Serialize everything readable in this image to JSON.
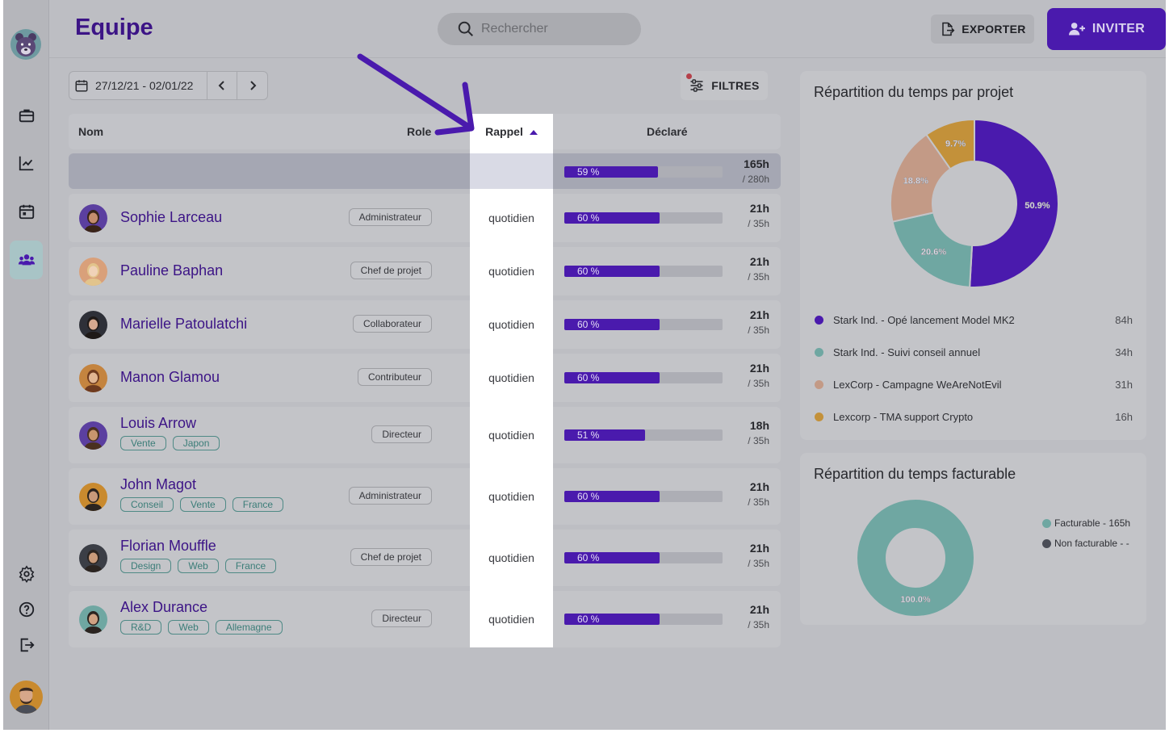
{
  "header": {
    "title": "Equipe",
    "search_placeholder": "Rechercher",
    "export_label": "EXPORTER",
    "invite_label": "INVITER"
  },
  "toolbar": {
    "date_range": "27/12/21 - 02/01/22",
    "filters_label": "FILTRES"
  },
  "table": {
    "columns": {
      "name": "Nom",
      "role": "Role",
      "reminder": "Rappel",
      "declared": "Déclaré"
    },
    "total": {
      "percent_label": "59 %",
      "percent": 59,
      "hours": "165h",
      "target": "/ 280h"
    },
    "rows": [
      {
        "name": "Sophie Larceau",
        "role": "Administrateur",
        "reminder": "quotidien",
        "percent_label": "60 %",
        "percent": 60,
        "hours": "21h",
        "target": "/ 35h",
        "tags": []
      },
      {
        "name": "Pauline Baphan",
        "role": "Chef de projet",
        "reminder": "quotidien",
        "percent_label": "60 %",
        "percent": 60,
        "hours": "21h",
        "target": "/ 35h",
        "tags": []
      },
      {
        "name": "Marielle Patoulatchi",
        "role": "Collaborateur",
        "reminder": "quotidien",
        "percent_label": "60 %",
        "percent": 60,
        "hours": "21h",
        "target": "/ 35h",
        "tags": []
      },
      {
        "name": "Manon Glamou",
        "role": "Contributeur",
        "reminder": "quotidien",
        "percent_label": "60 %",
        "percent": 60,
        "hours": "21h",
        "target": "/ 35h",
        "tags": []
      },
      {
        "name": "Louis Arrow",
        "role": "Directeur",
        "reminder": "quotidien",
        "percent_label": "51 %",
        "percent": 51,
        "hours": "18h",
        "target": "/ 35h",
        "tags": [
          "Vente",
          "Japon"
        ]
      },
      {
        "name": "John Magot",
        "role": "Administrateur",
        "reminder": "quotidien",
        "percent_label": "60 %",
        "percent": 60,
        "hours": "21h",
        "target": "/ 35h",
        "tags": [
          "Conseil",
          "Vente",
          "France"
        ]
      },
      {
        "name": "Florian Mouffle",
        "role": "Chef de projet",
        "reminder": "quotidien",
        "percent_label": "60 %",
        "percent": 60,
        "hours": "21h",
        "target": "/ 35h",
        "tags": [
          "Design",
          "Web",
          "France"
        ]
      },
      {
        "name": "Alex Durance",
        "role": "Directeur",
        "reminder": "quotidien",
        "percent_label": "60 %",
        "percent": 60,
        "hours": "21h",
        "target": "/ 35h",
        "tags": [
          "R&D",
          "Web",
          "Allemagne"
        ]
      }
    ]
  },
  "project_chart": {
    "title": "Répartition du temps par projet",
    "legend": [
      {
        "label": "Stark Ind. - Opé lancement Model MK2",
        "value": "84h",
        "color": "#4a1aad"
      },
      {
        "label": "Stark Ind. - Suivi conseil annuel",
        "value": "34h",
        "color": "#6fa7a2"
      },
      {
        "label": "LexCorp - Campagne WeAreNotEvil",
        "value": "31h",
        "color": "#c39a86"
      },
      {
        "label": "Lexcorp - TMA support Crypto",
        "value": "16h",
        "color": "#c3913a"
      }
    ]
  },
  "billable_chart": {
    "title": "Répartition du temps facturable",
    "legend": [
      {
        "label": "Facturable - 165h",
        "color": "#6fa7a2"
      },
      {
        "label": "Non facturable - -",
        "color": "#4a4d57"
      }
    ]
  },
  "chart_data": [
    {
      "type": "pie",
      "title": "Répartition du temps par projet",
      "categories": [
        "Stark Ind. - Opé lancement Model MK2",
        "Stark Ind. - Suivi conseil annuel",
        "LexCorp - Campagne WeAreNotEvil",
        "Lexcorp - TMA support Crypto"
      ],
      "values": [
        50.9,
        20.6,
        18.8,
        9.7
      ],
      "labels": [
        "50.9%",
        "20.6%",
        "18.8%",
        "9.7%"
      ],
      "colors": [
        "#4a1aad",
        "#6fa7a2",
        "#c39a86",
        "#c3913a"
      ]
    },
    {
      "type": "pie",
      "title": "Répartition du temps facturable",
      "categories": [
        "Facturable - 165h",
        "Non facturable - -"
      ],
      "values": [
        100.0,
        0
      ],
      "labels": [
        "100.0%"
      ],
      "colors": [
        "#6fa7a2",
        "#4a4d57"
      ]
    }
  ]
}
